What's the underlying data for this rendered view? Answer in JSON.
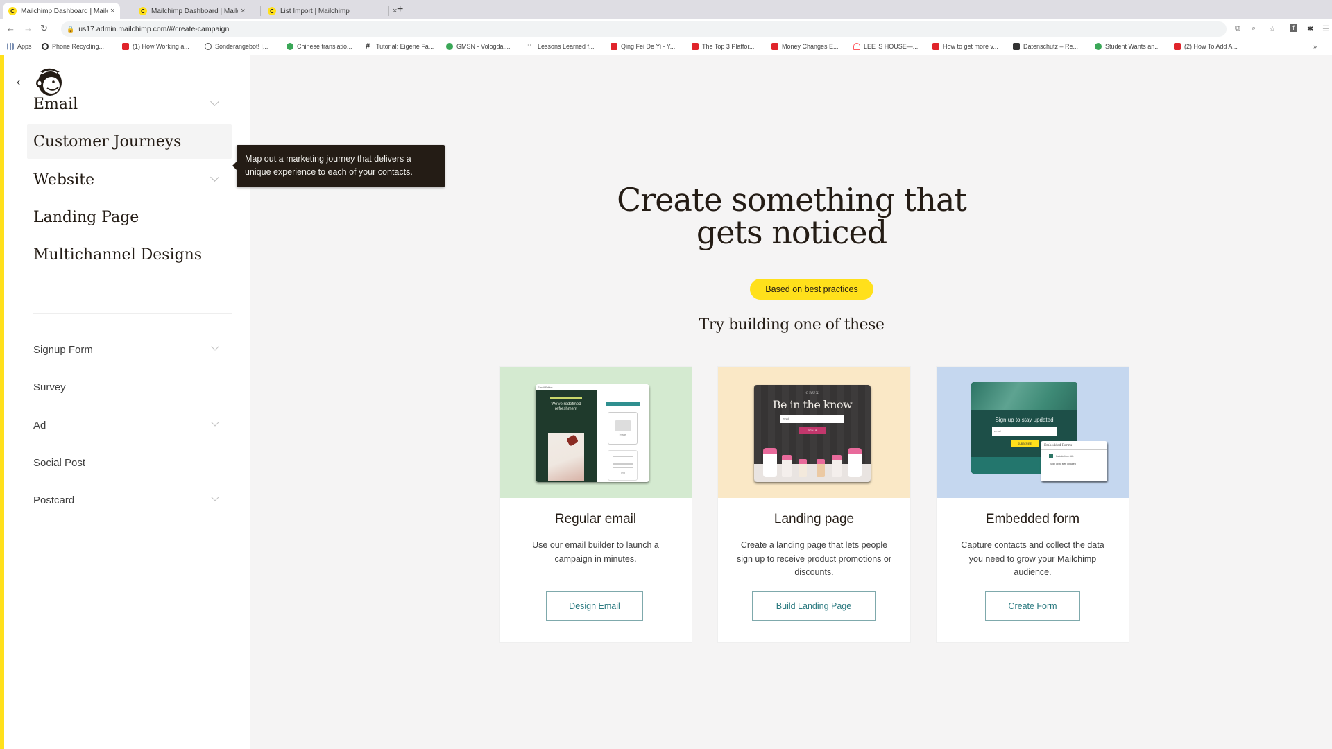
{
  "browser": {
    "tabs": [
      {
        "title": "Mailchimp Dashboard | Mailchi",
        "active": true
      },
      {
        "title": "Mailchimp Dashboard | Mailchi",
        "active": false
      },
      {
        "title": "List Import | Mailchimp",
        "active": false
      }
    ],
    "new_tab": "+",
    "close_glyph": "×",
    "url": "us17.admin.mailchimp.com/#/create-campaign",
    "bookmarks": [
      {
        "label": "Apps",
        "icon": "grid"
      },
      {
        "label": "Phone Recycling...",
        "icon": "o2"
      },
      {
        "label": "(1) How Working a...",
        "icon": "yt"
      },
      {
        "label": "Sonderangebot! |...",
        "icon": "sond"
      },
      {
        "label": "Chinese translatio...",
        "icon": "green"
      },
      {
        "label": "Tutorial: Eigene Fa...",
        "icon": "hash"
      },
      {
        "label": "GMSN - Vologda,...",
        "icon": "green"
      },
      {
        "label": "Lessons Learned f...",
        "icon": "lesson"
      },
      {
        "label": "Qing Fei De Yi - Y...",
        "icon": "yt"
      },
      {
        "label": "The Top 3 Platfor...",
        "icon": "yt"
      },
      {
        "label": "Money Changes E...",
        "icon": "yt"
      },
      {
        "label": "LEE 'S HOUSE—...",
        "icon": "air"
      },
      {
        "label": "How to get more v...",
        "icon": "yt"
      },
      {
        "label": "Datenschutz – Re...",
        "icon": "dark"
      },
      {
        "label": "Student Wants an...",
        "icon": "green"
      },
      {
        "label": "(2) How To Add A...",
        "icon": "yt"
      }
    ]
  },
  "sidebar": {
    "back_glyph": "‹",
    "primary_items": [
      {
        "label": "Email",
        "has_chevron": true
      },
      {
        "label": "Customer Journeys",
        "has_chevron": false,
        "hovered": true
      },
      {
        "label": "Website",
        "has_chevron": true
      },
      {
        "label": "Landing Page",
        "has_chevron": false
      },
      {
        "label": "Multichannel Designs",
        "has_chevron": false
      }
    ],
    "secondary_items": [
      {
        "label": "Signup Form",
        "has_chevron": true
      },
      {
        "label": "Survey",
        "has_chevron": false
      },
      {
        "label": "Ad",
        "has_chevron": true
      },
      {
        "label": "Social Post",
        "has_chevron": false
      },
      {
        "label": "Postcard",
        "has_chevron": true
      }
    ],
    "tooltip": "Map out a marketing journey that delivers a unique experience to each of your contacts."
  },
  "main": {
    "headline_line1": "Create something that",
    "headline_line2": "gets noticed",
    "badge": "Based on best practices",
    "subheading": "Try building one of these",
    "cards": [
      {
        "title": "Regular email",
        "description": "Use our email builder to launch a campaign in minutes.",
        "button": "Design Email",
        "hero_color": "#d4ead0",
        "mock": {
          "editor_label": "Email Editor",
          "headline": "We've redefined refreshment",
          "block_label": "Image",
          "text_label": "Text"
        }
      },
      {
        "title": "Landing page",
        "description": "Create a landing page that lets people sign up to receive product promotions or discounts.",
        "button": "Build Landing Page",
        "hero_color": "#fae8c6",
        "mock": {
          "brand": "CRUX",
          "headline": "Be in the know",
          "input": "email",
          "cta": "SIGN UP"
        }
      },
      {
        "title": "Embedded form",
        "description": "Capture contacts and collect the data you need to grow your Mailchimp audience.",
        "button": "Create Form",
        "hero_color": "#c5d7ef",
        "mock": {
          "headline": "Sign up to stay updated",
          "input": "email",
          "cta": "SUBSCRIBE",
          "panel_title": "Embedded Forms",
          "panel_option": "Include form title",
          "panel_value": "Sign up to stay updated"
        }
      }
    ]
  },
  "colors": {
    "brand_yellow": "#ffe01b",
    "ink": "#241c15",
    "button_teal": "#2b7a80"
  }
}
